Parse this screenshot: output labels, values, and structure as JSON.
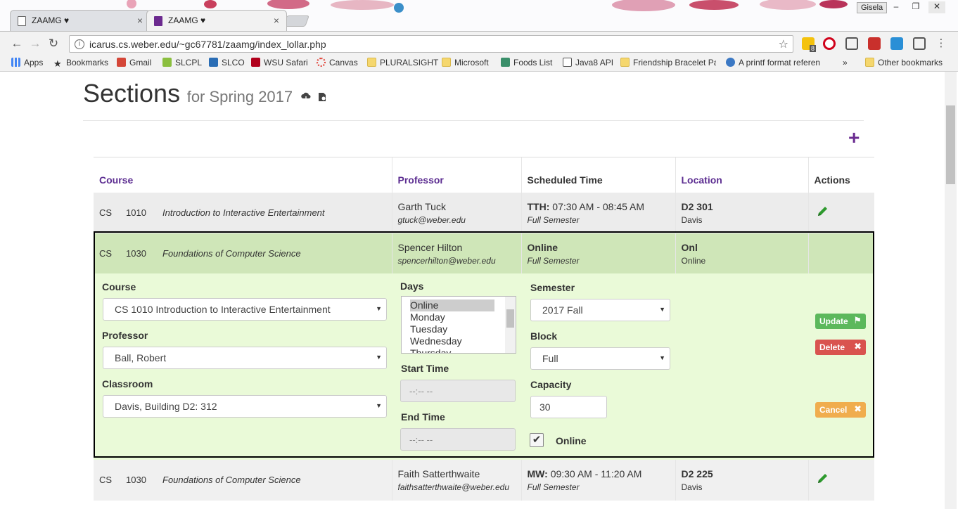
{
  "browser": {
    "tabs": [
      {
        "title": "ZAAMG ♥",
        "active": false
      },
      {
        "title": "ZAAMG ♥",
        "active": true
      }
    ],
    "profile_name": "Gisela",
    "url": "icarus.cs.weber.edu/~gc67781/zaamg/index_lollar.php",
    "bookmarks": [
      {
        "label": "Apps",
        "icon": "apps-grid-icon"
      },
      {
        "label": "Bookmarks",
        "icon": "star-icon"
      },
      {
        "label": "Gmail",
        "icon": "gmail-icon"
      },
      {
        "label": "SLCPL",
        "icon": "slcpl-icon"
      },
      {
        "label": "SLCO",
        "icon": "slco-icon"
      },
      {
        "label": "WSU Safari",
        "icon": "safari-icon"
      },
      {
        "label": "Canvas",
        "icon": "canvas-icon"
      },
      {
        "label": "PLURALSIGHT",
        "icon": "folder-icon"
      },
      {
        "label": "Microsoft",
        "icon": "folder-icon"
      },
      {
        "label": "Foods List",
        "icon": "foods-icon"
      },
      {
        "label": "Java8 API",
        "icon": "page-icon"
      },
      {
        "label": "Friendship Bracelet Pa",
        "icon": "folder-icon"
      },
      {
        "label": "A printf format referen",
        "icon": "globe-icon"
      },
      {
        "label": "»",
        "icon": "overflow-icon"
      },
      {
        "label": "Other bookmarks",
        "icon": "folder-icon"
      }
    ],
    "extension_badge": "8"
  },
  "page": {
    "title": "Sections",
    "subtitle": "for Spring 2017",
    "add_symbol": "+"
  },
  "table": {
    "headers": {
      "course": "Course",
      "professor": "Professor",
      "scheduled_time": "Scheduled Time",
      "location": "Location",
      "actions": "Actions"
    },
    "rows": [
      {
        "dept": "CS",
        "num": "1010",
        "title": "Introduction to Interactive Entertainment",
        "prof_name": "Garth Tuck",
        "prof_email": "gtuck@weber.edu",
        "days": "TTH:",
        "time": "07:30 AM - 08:45 AM",
        "block": "Full Semester",
        "room": "D2 301",
        "campus": "Davis"
      },
      {
        "dept": "CS",
        "num": "1030",
        "title": "Foundations of Computer Science",
        "prof_name": "Spencer Hilton",
        "prof_email": "spencerhilton@weber.edu",
        "days": "Online",
        "time": "",
        "block": "Full Semester",
        "room": "Onl",
        "campus": "Online"
      },
      {
        "dept": "CS",
        "num": "1030",
        "title": "Foundations of Computer Science",
        "prof_name": "Faith Satterthwaite",
        "prof_email": "faithsatterthwaite@weber.edu",
        "days": "MW:",
        "time": "09:30 AM - 11:20 AM",
        "block": "Full Semester",
        "room": "D2 225",
        "campus": "Davis"
      }
    ]
  },
  "editor": {
    "course_label": "Course",
    "course_value": "CS 1010 Introduction to Interactive Entertainment",
    "professor_label": "Professor",
    "professor_value": "Ball, Robert",
    "classroom_label": "Classroom",
    "classroom_value": "Davis, Building D2: 312",
    "days_label": "Days",
    "days_options": [
      "Online",
      "Monday",
      "Tuesday",
      "Wednesday",
      "Thursday"
    ],
    "days_selected": "Online",
    "start_label": "Start Time",
    "start_value": "--:-- --",
    "end_label": "End Time",
    "end_value": "--:-- --",
    "semester_label": "Semester",
    "semester_value": "2017 Fall",
    "block_label": "Block",
    "block_value": "Full",
    "capacity_label": "Capacity",
    "capacity_value": "30",
    "online_label": "Online",
    "online_checked": true,
    "update_label": "Update",
    "delete_label": "Delete",
    "cancel_label": "Cancel"
  },
  "colors": {
    "brand_purple": "#5c2d91",
    "selected_row": "#cfe6b8",
    "editor_bg": "#eafad8",
    "update_btn": "#5cb85c",
    "delete_btn": "#d9534f",
    "cancel_btn": "#f0ad4e"
  }
}
